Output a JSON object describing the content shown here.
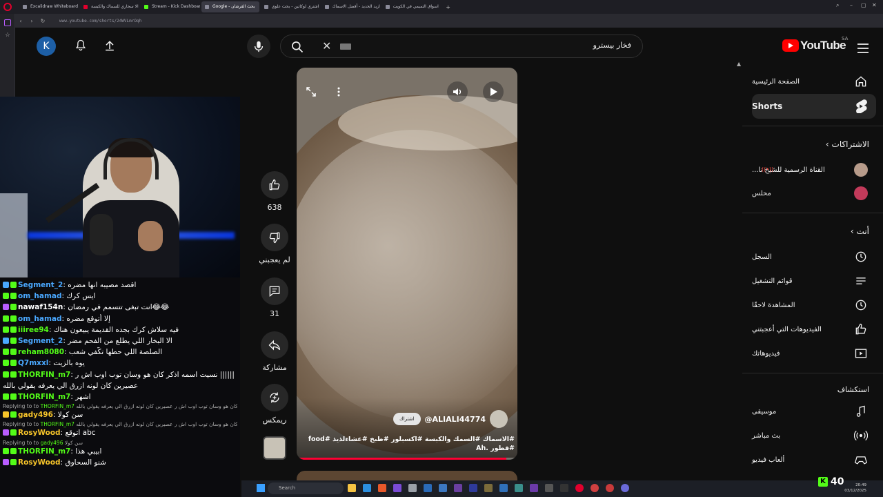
{
  "browser": {
    "tabs": [
      {
        "label": "Excalidraw Whiteboard",
        "kind": "default"
      },
      {
        "label": "الا سحاري للسماك والكبسة",
        "kind": "yt"
      },
      {
        "label": "Stream - Kick Dashboard",
        "kind": "kick"
      },
      {
        "label": "Google - بحث القرشان",
        "kind": "active"
      },
      {
        "label": "اشتري لوكاتين - بحث علوي",
        "kind": "default"
      },
      {
        "label": "كيف ازيد الحديد - أفضل الاسماك",
        "kind": "default"
      },
      {
        "label": "اسواق التميمي في الكويت",
        "kind": "default"
      }
    ],
    "new_tab": "+",
    "url": "www.youtube.com/shorts/24WVLmrOqh"
  },
  "header": {
    "avatar_letter": "K",
    "search_query": "فخار بيسترو",
    "logo_text": "YouTube",
    "country_code": "SA"
  },
  "guide": {
    "home": "الصفحة الرئيسية",
    "shorts": "Shorts",
    "subscriptions_title": "الاشتراكات",
    "subscriptions": [
      {
        "name": "القناة الرسمية للشيخ نا...",
        "live": true,
        "color": "#b79b8a"
      },
      {
        "name": "محلس",
        "live": false,
        "color": "#c23a5a"
      }
    ],
    "you_title": "أنت",
    "you_items": [
      "السجل",
      "قوائم التشغيل",
      "المشاهدة لاحقًا",
      "الفيديوهات التي أعجبتني",
      "فيديوهاتك"
    ],
    "explore_title": "استكشاف",
    "explore_items": [
      "موسيقى",
      "بث مباشر",
      "ألعاب فيديو"
    ]
  },
  "short": {
    "channel_handle": "@ALIALI44774",
    "subscribe_label": "اشتراك",
    "caption": "#الاسماك #السمك والكبسة #اكسبلور #طبخ #عشاءلذيذ #food #فطور .Ah",
    "progress": 0.95
  },
  "actions": {
    "likes": "638",
    "dislike_label": "لم يعجبني",
    "comments": "31",
    "share_label": "مشاركة",
    "remix_label": "ريمكس"
  },
  "chat": [
    {
      "user": "Segment_2",
      "msg": "اقصد مصيبه انها مضره",
      "color": "#4aa8ff",
      "badge": "b-blue"
    },
    {
      "user": "om_hamad",
      "msg": "ايس كرك",
      "color": "#4aa8ff",
      "badge": "b-green"
    },
    {
      "user": "nawaf154n",
      "msg": "انت تبغى تتسمم في رمضان😂😂",
      "color": "#fff",
      "badge": "b-purple"
    },
    {
      "user": "om_hamad",
      "msg": "إلا أتوقع مضره",
      "color": "#4aa8ff",
      "badge": "b-green"
    },
    {
      "user": "iiiree94",
      "msg": "فيه سلاش كرك بجده القديمة يبيعون هناك",
      "color": "#53fc18",
      "badge": "b-green"
    },
    {
      "user": "Segment_2",
      "msg": "الا البخار اللي يطلع من الفحم مضر",
      "color": "#4aa8ff",
      "badge": "b-blue"
    },
    {
      "user": "reham8080",
      "msg": "الصلصة اللي حطها تكّفي شعب",
      "color": "#53fc18",
      "badge": "b-green"
    },
    {
      "user": "Q7mxxl",
      "msg": "يوه بالزيت",
      "color": "#4aa8ff",
      "badge": "b-green"
    },
    {
      "user": "THORFIN_m7",
      "msg": "نسيت اسمه اذكر كان هو وسان توب اوب اش ر ||||||",
      "color": "#53fc18",
      "badge": "b-green"
    },
    {
      "user": "",
      "msg": "عصيرين كان لونه ازرق الي يعرفه يقولي بالله",
      "color": "#fff",
      "badge": ""
    },
    {
      "user": "THORFIN_m7",
      "msg": "اشهر",
      "color": "#53fc18",
      "badge": "b-green"
    }
  ],
  "chat_replies": [
    {
      "to": "THORFIN_m7",
      "text": "نسيت اسمه اذكر كان هو وسان توب اوب اش ر عصيرين كان لونه ازرق الي يعرفه يقولي بالله"
    },
    {
      "user": "gady496",
      "msg": "سن كولا",
      "color": "#f7c52a",
      "badge": "b-gold"
    },
    {
      "to": "THORFIN_m7",
      "text": "نسيت اسمه اذكر كان هو وسان توب اوب اش ر عصيرين كان لونه ازرق الي يعرفه يقولي بالله"
    },
    {
      "user": "RosyWood",
      "msg": "اتوقع abc",
      "color": "#f7c52a",
      "badge": "b-purple"
    },
    {
      "to": "gady496",
      "text": "سن كولا"
    },
    {
      "user": "THORFIN_m7",
      "msg": "ابيبي هذا",
      "color": "#53fc18",
      "badge": "b-green"
    },
    {
      "user": "RosyWood",
      "msg": "شنو السحاوق",
      "color": "#f7c52a",
      "badge": "b-purple"
    }
  ],
  "replying_prefix": "Replying to",
  "taskbar": {
    "search_placeholder": "Search",
    "time": "20:49",
    "date": "03/12/2025"
  },
  "kick": {
    "viewer_count": "40"
  }
}
